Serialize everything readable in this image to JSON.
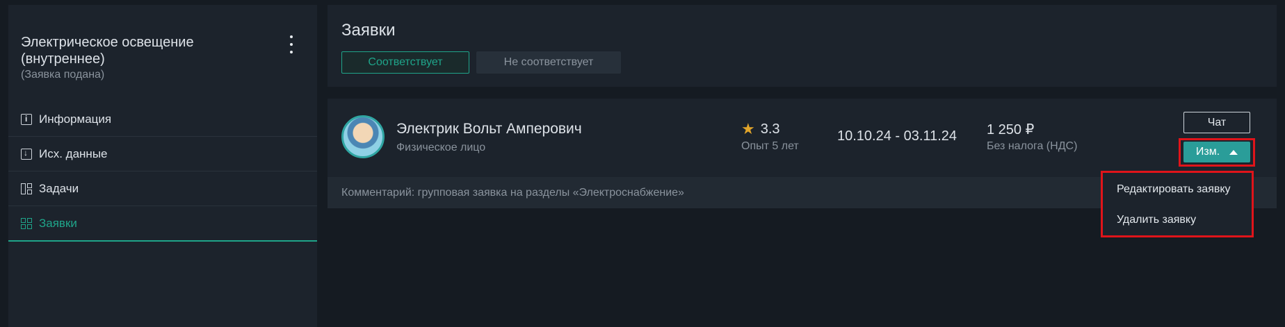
{
  "sidebar": {
    "title_line1": "Электрическое освещение",
    "title_line2": "(внутреннее)",
    "subtitle": "(Заявка подана)",
    "items": [
      {
        "label": "Информация",
        "icon": "info-icon"
      },
      {
        "label": "Исх. данные",
        "icon": "download-icon"
      },
      {
        "label": "Задачи",
        "icon": "tasks-icon"
      },
      {
        "label": "Заявки",
        "icon": "applications-icon",
        "active": true
      }
    ]
  },
  "main": {
    "title": "Заявки",
    "tabs": [
      {
        "label": "Соответствует",
        "selected": true
      },
      {
        "label": "Не соответствует",
        "selected": false
      }
    ]
  },
  "card": {
    "name": "Электрик Вольт Амперович",
    "person_type": "Физическое лицо",
    "rating": "3.3",
    "experience": "Опыт 5 лет",
    "dates": "10.10.24 - 03.11.24",
    "price": "1 250 ₽",
    "tax": "Без налога (НДС)",
    "chat_label": "Чат",
    "edit_label": "Изм.",
    "comment": "Комментарий: групповая заявка на разделы «Электроснабжение»"
  },
  "dropdown": {
    "items": [
      "Редактировать заявку",
      "Удалить заявку"
    ]
  },
  "colors": {
    "background": "#151b22",
    "panel": "#1c232c",
    "accent": "#1fa58a",
    "button": "#2a9d99",
    "highlight": "#e0141a",
    "star": "#e2a52a"
  }
}
